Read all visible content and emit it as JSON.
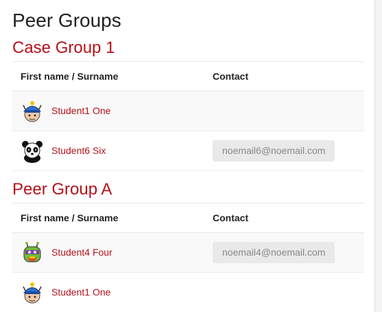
{
  "page_title": "Peer Groups",
  "groups": [
    {
      "title": "Case Group 1",
      "headers": {
        "name": "First name / Surname",
        "contact": "Contact"
      },
      "members": [
        {
          "name": "Student1 One",
          "email": "",
          "avatar": "knight-avatar-icon"
        },
        {
          "name": "Student6 Six",
          "email": "noemail6@noemail.com",
          "avatar": "panda-avatar-icon"
        }
      ]
    },
    {
      "title": "Peer Group A",
      "headers": {
        "name": "First name / Surname",
        "contact": "Contact"
      },
      "members": [
        {
          "name": "Student4 Four",
          "email": "noemail4@noemail.com",
          "avatar": "monster-avatar-icon"
        },
        {
          "name": "Student1 One",
          "email": "",
          "avatar": "knight-avatar-icon"
        }
      ]
    }
  ],
  "colors": {
    "accent": "#b5121b",
    "stripe": "#f9f9f9",
    "email_bg": "#e9e9e9"
  }
}
